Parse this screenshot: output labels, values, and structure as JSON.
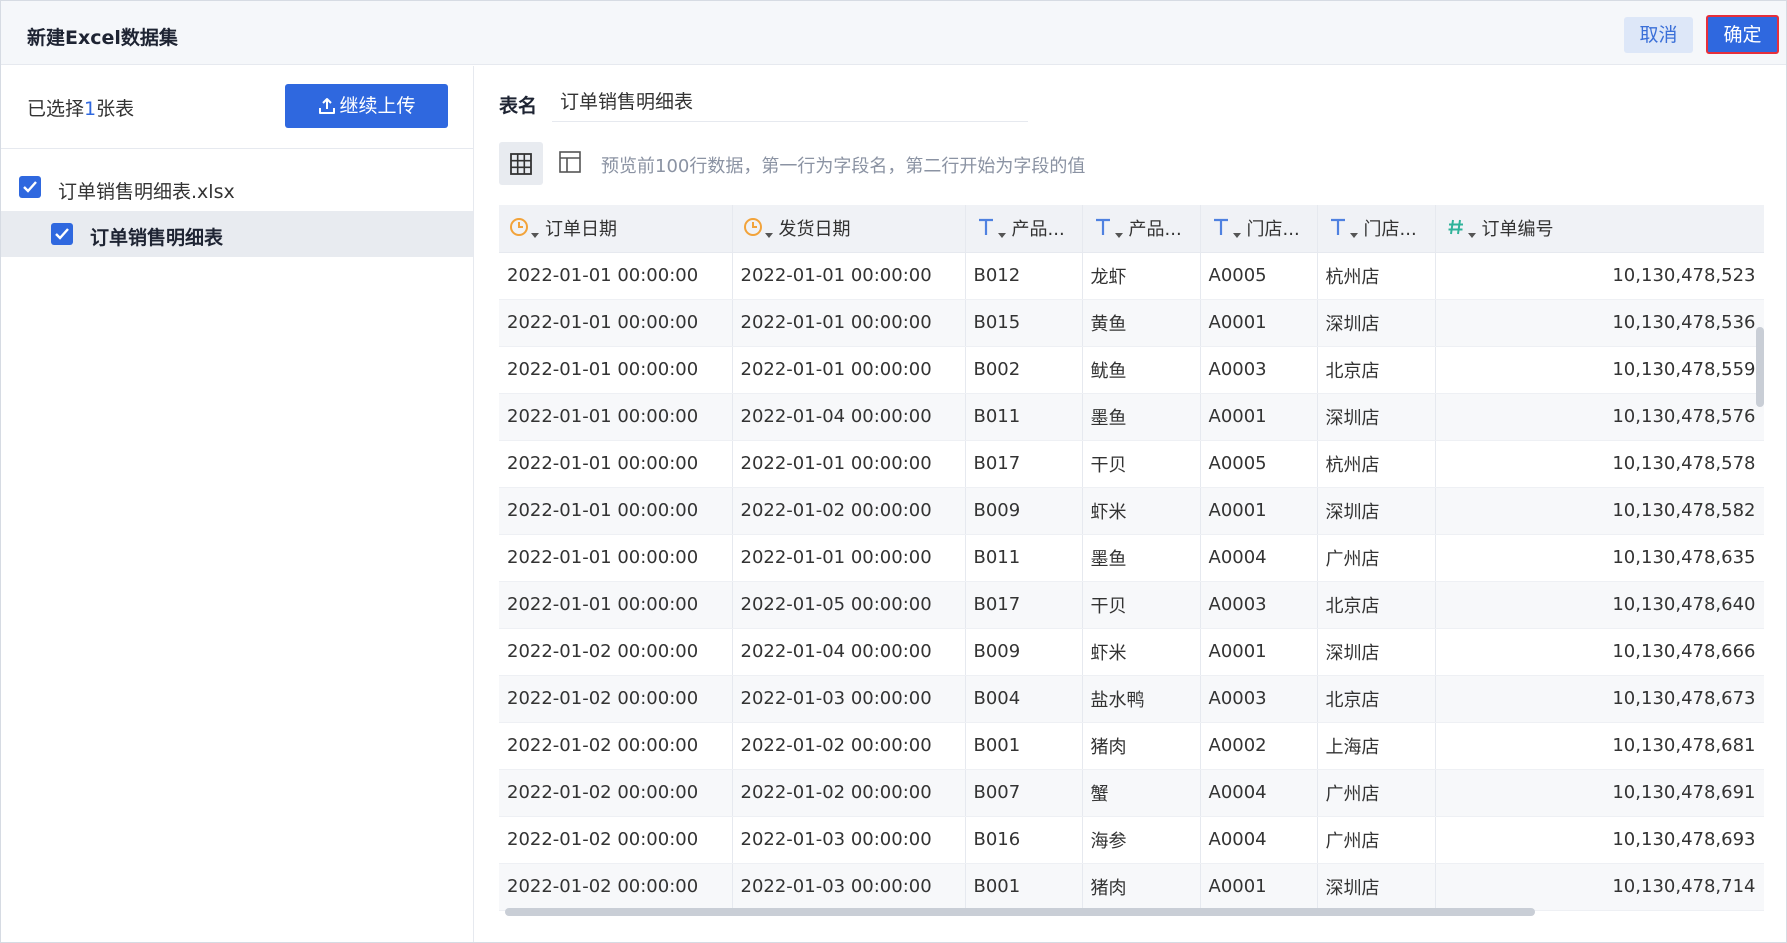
{
  "dialog": {
    "title": "新建Excel数据集",
    "cancel_label": "取消",
    "ok_label": "确定"
  },
  "left": {
    "selected_prefix": "已选择",
    "selected_count": "1",
    "selected_suffix": "张表",
    "upload_label": "继续上传",
    "file_name": "订单销售明细表.xlsx",
    "sheet_name": "订单销售明细表"
  },
  "right": {
    "name_label": "表名",
    "name_value": "订单销售明细表",
    "preview_hint": "预览前100行数据，第一行为字段名，第二行开始为字段的值"
  },
  "colors": {
    "primary": "#2f68df",
    "date_icon": "#f2a33a",
    "text_icon": "#4f81e0",
    "number_icon": "#2fb39a"
  },
  "columns": [
    {
      "label": "订单日期",
      "type": "date"
    },
    {
      "label": "发货日期",
      "type": "date"
    },
    {
      "label": "产品...",
      "type": "text"
    },
    {
      "label": "产品...",
      "type": "text"
    },
    {
      "label": "门店...",
      "type": "text"
    },
    {
      "label": "门店...",
      "type": "text"
    },
    {
      "label": "订单编号",
      "type": "number"
    }
  ],
  "rows": [
    [
      "2022-01-01 00:00:00",
      "2022-01-01 00:00:00",
      "B012",
      "龙虾",
      "A0005",
      "杭州店",
      "10,130,478,523"
    ],
    [
      "2022-01-01 00:00:00",
      "2022-01-01 00:00:00",
      "B015",
      "黄鱼",
      "A0001",
      "深圳店",
      "10,130,478,536"
    ],
    [
      "2022-01-01 00:00:00",
      "2022-01-01 00:00:00",
      "B002",
      "鱿鱼",
      "A0003",
      "北京店",
      "10,130,478,559"
    ],
    [
      "2022-01-01 00:00:00",
      "2022-01-04 00:00:00",
      "B011",
      "墨鱼",
      "A0001",
      "深圳店",
      "10,130,478,576"
    ],
    [
      "2022-01-01 00:00:00",
      "2022-01-01 00:00:00",
      "B017",
      "干贝",
      "A0005",
      "杭州店",
      "10,130,478,578"
    ],
    [
      "2022-01-01 00:00:00",
      "2022-01-02 00:00:00",
      "B009",
      "虾米",
      "A0001",
      "深圳店",
      "10,130,478,582"
    ],
    [
      "2022-01-01 00:00:00",
      "2022-01-01 00:00:00",
      "B011",
      "墨鱼",
      "A0004",
      "广州店",
      "10,130,478,635"
    ],
    [
      "2022-01-01 00:00:00",
      "2022-01-05 00:00:00",
      "B017",
      "干贝",
      "A0003",
      "北京店",
      "10,130,478,640"
    ],
    [
      "2022-01-02 00:00:00",
      "2022-01-04 00:00:00",
      "B009",
      "虾米",
      "A0001",
      "深圳店",
      "10,130,478,666"
    ],
    [
      "2022-01-02 00:00:00",
      "2022-01-03 00:00:00",
      "B004",
      "盐水鸭",
      "A0003",
      "北京店",
      "10,130,478,673"
    ],
    [
      "2022-01-02 00:00:00",
      "2022-01-02 00:00:00",
      "B001",
      "猪肉",
      "A0002",
      "上海店",
      "10,130,478,681"
    ],
    [
      "2022-01-02 00:00:00",
      "2022-01-02 00:00:00",
      "B007",
      "蟹",
      "A0004",
      "广州店",
      "10,130,478,691"
    ],
    [
      "2022-01-02 00:00:00",
      "2022-01-03 00:00:00",
      "B016",
      "海参",
      "A0004",
      "广州店",
      "10,130,478,693"
    ],
    [
      "2022-01-02 00:00:00",
      "2022-01-03 00:00:00",
      "B001",
      "猪肉",
      "A0001",
      "深圳店",
      "10,130,478,714"
    ]
  ]
}
